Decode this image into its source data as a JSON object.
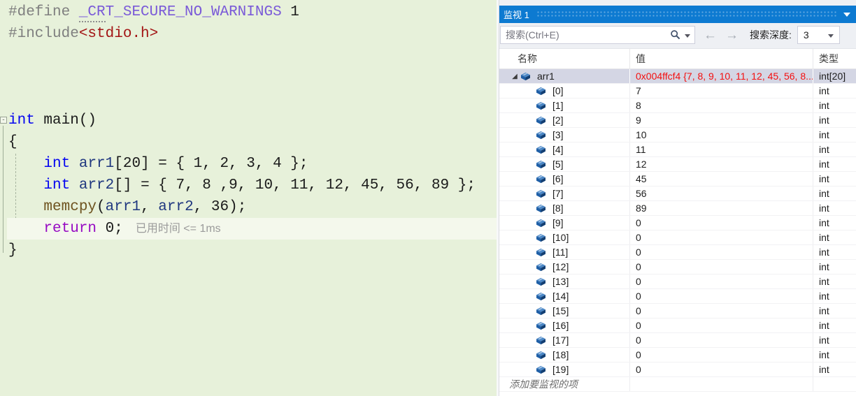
{
  "editor": {
    "perftip": "已用时间 <= 1ms",
    "lines": [
      {
        "tokens": [
          {
            "t": "#define ",
            "c": "pp"
          },
          {
            "t": "_CR",
            "c": "macro dots"
          },
          {
            "t": "T_SECURE_NO_WARNINGS",
            "c": "macro"
          },
          {
            "t": " 1",
            "c": "plain"
          }
        ]
      },
      {
        "tokens": [
          {
            "t": "#include",
            "c": "pp"
          },
          {
            "t": "<stdio.h>",
            "c": "str"
          }
        ]
      },
      {
        "tokens": []
      },
      {
        "tokens": []
      },
      {
        "tokens": []
      },
      {
        "tokens": [
          {
            "t": "int",
            "c": "kw"
          },
          {
            "t": " main()",
            "c": "plain"
          }
        ]
      },
      {
        "tokens": [
          {
            "t": "{",
            "c": "plain"
          }
        ]
      },
      {
        "tokens": [
          {
            "t": "    ",
            "c": "plain"
          },
          {
            "t": "int",
            "c": "kw"
          },
          {
            "t": " ",
            "c": "plain"
          },
          {
            "t": "arr1",
            "c": "var"
          },
          {
            "t": "[20] = { 1, 2, 3, 4 };",
            "c": "plain"
          }
        ]
      },
      {
        "tokens": [
          {
            "t": "    ",
            "c": "plain"
          },
          {
            "t": "int",
            "c": "kw"
          },
          {
            "t": " ",
            "c": "plain"
          },
          {
            "t": "arr2",
            "c": "var"
          },
          {
            "t": "[] = { 7, 8 ,9, 10, 11, 12, 45, 56, 89 };",
            "c": "plain"
          }
        ]
      },
      {
        "tokens": [
          {
            "t": "    ",
            "c": "plain"
          },
          {
            "t": "memcpy",
            "c": "fn"
          },
          {
            "t": "(",
            "c": "plain"
          },
          {
            "t": "arr1",
            "c": "var"
          },
          {
            "t": ", ",
            "c": "plain"
          },
          {
            "t": "arr2",
            "c": "var"
          },
          {
            "t": ", 36);",
            "c": "plain"
          }
        ]
      },
      {
        "tokens": [
          {
            "t": "    ",
            "c": "plain"
          },
          {
            "t": "return",
            "c": "ctrl"
          },
          {
            "t": " 0;",
            "c": "plain"
          }
        ],
        "current": true,
        "perftip": true
      },
      {
        "tokens": [
          {
            "t": "}",
            "c": "plain"
          }
        ]
      }
    ]
  },
  "watch": {
    "title": "监视 1",
    "search_placeholder": "搜索(Ctrl+E)",
    "back_arrow": "←",
    "forward_arrow": "→",
    "depth_label": "搜索深度:",
    "depth_value": "3",
    "columns": [
      "名称",
      "值",
      "类型"
    ],
    "rows": [
      {
        "name": "arr1",
        "value": "0x004ffcf4 {7, 8, 9, 10, 11, 12, 45, 56, 8...",
        "type": "int[20]",
        "level": 0,
        "expanded": true,
        "selected": true,
        "changed": true
      },
      {
        "name": "[0]",
        "value": "7",
        "type": "int",
        "level": 1
      },
      {
        "name": "[1]",
        "value": "8",
        "type": "int",
        "level": 1
      },
      {
        "name": "[2]",
        "value": "9",
        "type": "int",
        "level": 1
      },
      {
        "name": "[3]",
        "value": "10",
        "type": "int",
        "level": 1
      },
      {
        "name": "[4]",
        "value": "11",
        "type": "int",
        "level": 1
      },
      {
        "name": "[5]",
        "value": "12",
        "type": "int",
        "level": 1
      },
      {
        "name": "[6]",
        "value": "45",
        "type": "int",
        "level": 1
      },
      {
        "name": "[7]",
        "value": "56",
        "type": "int",
        "level": 1
      },
      {
        "name": "[8]",
        "value": "89",
        "type": "int",
        "level": 1
      },
      {
        "name": "[9]",
        "value": "0",
        "type": "int",
        "level": 1
      },
      {
        "name": "[10]",
        "value": "0",
        "type": "int",
        "level": 1
      },
      {
        "name": "[11]",
        "value": "0",
        "type": "int",
        "level": 1
      },
      {
        "name": "[12]",
        "value": "0",
        "type": "int",
        "level": 1
      },
      {
        "name": "[13]",
        "value": "0",
        "type": "int",
        "level": 1
      },
      {
        "name": "[14]",
        "value": "0",
        "type": "int",
        "level": 1
      },
      {
        "name": "[15]",
        "value": "0",
        "type": "int",
        "level": 1
      },
      {
        "name": "[16]",
        "value": "0",
        "type": "int",
        "level": 1
      },
      {
        "name": "[17]",
        "value": "0",
        "type": "int",
        "level": 1
      },
      {
        "name": "[18]",
        "value": "0",
        "type": "int",
        "level": 1
      },
      {
        "name": "[19]",
        "value": "0",
        "type": "int",
        "level": 1
      }
    ],
    "add_row": "添加要监视的项"
  },
  "colors": {
    "editor_background": "#e7f1da",
    "titlebar_blue": "#0d7ad1",
    "changed_value_red": "#f40f0f",
    "selected_row": "#d4d6e4",
    "variable_icon_blue": "#1f5fa6"
  },
  "icons": {
    "fold_collapse": "-",
    "expanded_triangle": "◢"
  }
}
